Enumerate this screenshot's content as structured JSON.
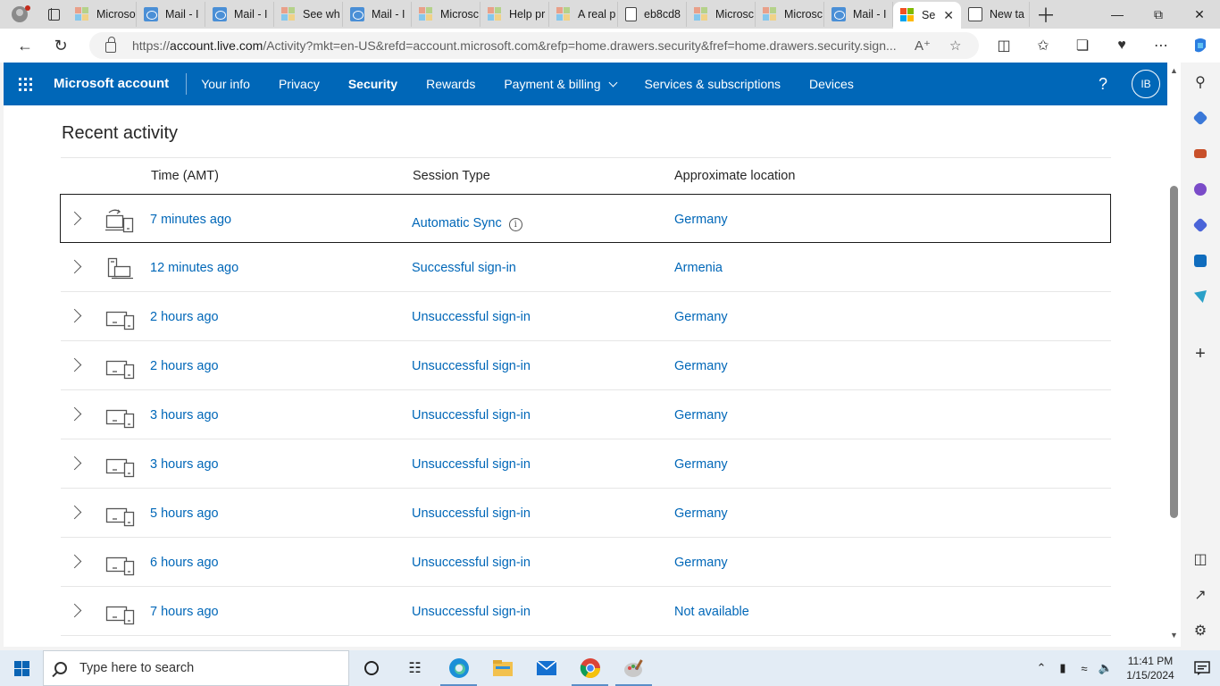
{
  "browser": {
    "tabs": [
      {
        "label": "Microsof",
        "favicon": "microsoft-logo-icon"
      },
      {
        "label": "Mail - I",
        "favicon": "outlook-icon"
      },
      {
        "label": "Mail - I",
        "favicon": "outlook-icon"
      },
      {
        "label": "See wh",
        "favicon": "microsoft-logo-icon"
      },
      {
        "label": "Mail - I",
        "favicon": "outlook-icon"
      },
      {
        "label": "Microsc",
        "favicon": "microsoft-logo-icon"
      },
      {
        "label": "Help pr",
        "favicon": "microsoft-logo-icon"
      },
      {
        "label": "A real p",
        "favicon": "microsoft-logo-icon"
      },
      {
        "label": "eb8cd8",
        "favicon": "document-icon"
      },
      {
        "label": "Microsc",
        "favicon": "microsoft-logo-icon"
      },
      {
        "label": "Microsc",
        "favicon": "microsoft-logo-icon"
      },
      {
        "label": "Mail - I",
        "favicon": "outlook-icon"
      },
      {
        "label": "Se",
        "favicon": "microsoft-logo-icon",
        "active": true
      },
      {
        "label": "New ta",
        "favicon": "new-tab-icon"
      }
    ],
    "url_host": "account.live.com",
    "url_prefix": "https://",
    "url_rest": "/Activity?mkt=en-US&refd=account.microsoft.com&refp=home.drawers.security&fref=home.drawers.security.sign..."
  },
  "msnav": {
    "brand": "Microsoft account",
    "items": [
      {
        "label": "Your info"
      },
      {
        "label": "Privacy"
      },
      {
        "label": "Security",
        "active": true
      },
      {
        "label": "Rewards"
      },
      {
        "label": "Payment & billing",
        "dropdown": true
      },
      {
        "label": "Services & subscriptions"
      },
      {
        "label": "Devices"
      }
    ],
    "help": "?",
    "avatar_initials": "IB"
  },
  "activity": {
    "title": "Recent activity",
    "columns": {
      "time": "Time (AMT)",
      "session_type": "Session Type",
      "location": "Approximate location"
    },
    "rows": [
      {
        "time": "7 minutes ago",
        "session_type": "Automatic Sync",
        "location": "Germany",
        "device": "sync-devices-icon",
        "info": true,
        "selected": true
      },
      {
        "time": "12 minutes ago",
        "session_type": "Successful sign-in",
        "location": "Armenia",
        "device": "desktop-laptop-icon"
      },
      {
        "time": "2 hours ago",
        "session_type": "Unsuccessful sign-in",
        "location": "Germany",
        "device": "devices-icon"
      },
      {
        "time": "2 hours ago",
        "session_type": "Unsuccessful sign-in",
        "location": "Germany",
        "device": "devices-icon"
      },
      {
        "time": "3 hours ago",
        "session_type": "Unsuccessful sign-in",
        "location": "Germany",
        "device": "devices-icon"
      },
      {
        "time": "3 hours ago",
        "session_type": "Unsuccessful sign-in",
        "location": "Germany",
        "device": "devices-icon"
      },
      {
        "time": "5 hours ago",
        "session_type": "Unsuccessful sign-in",
        "location": "Germany",
        "device": "devices-icon"
      },
      {
        "time": "6 hours ago",
        "session_type": "Unsuccessful sign-in",
        "location": "Germany",
        "device": "devices-icon"
      },
      {
        "time": "7 hours ago",
        "session_type": "Unsuccessful sign-in",
        "location": "Not available",
        "device": "devices-icon"
      }
    ]
  },
  "taskbar": {
    "search_placeholder": "Type here to search",
    "time": "11:41 PM",
    "date": "1/15/2024"
  },
  "colors": {
    "accent": "#0067b8",
    "link": "#0067b8",
    "taskbar": "#e3ecf5"
  }
}
